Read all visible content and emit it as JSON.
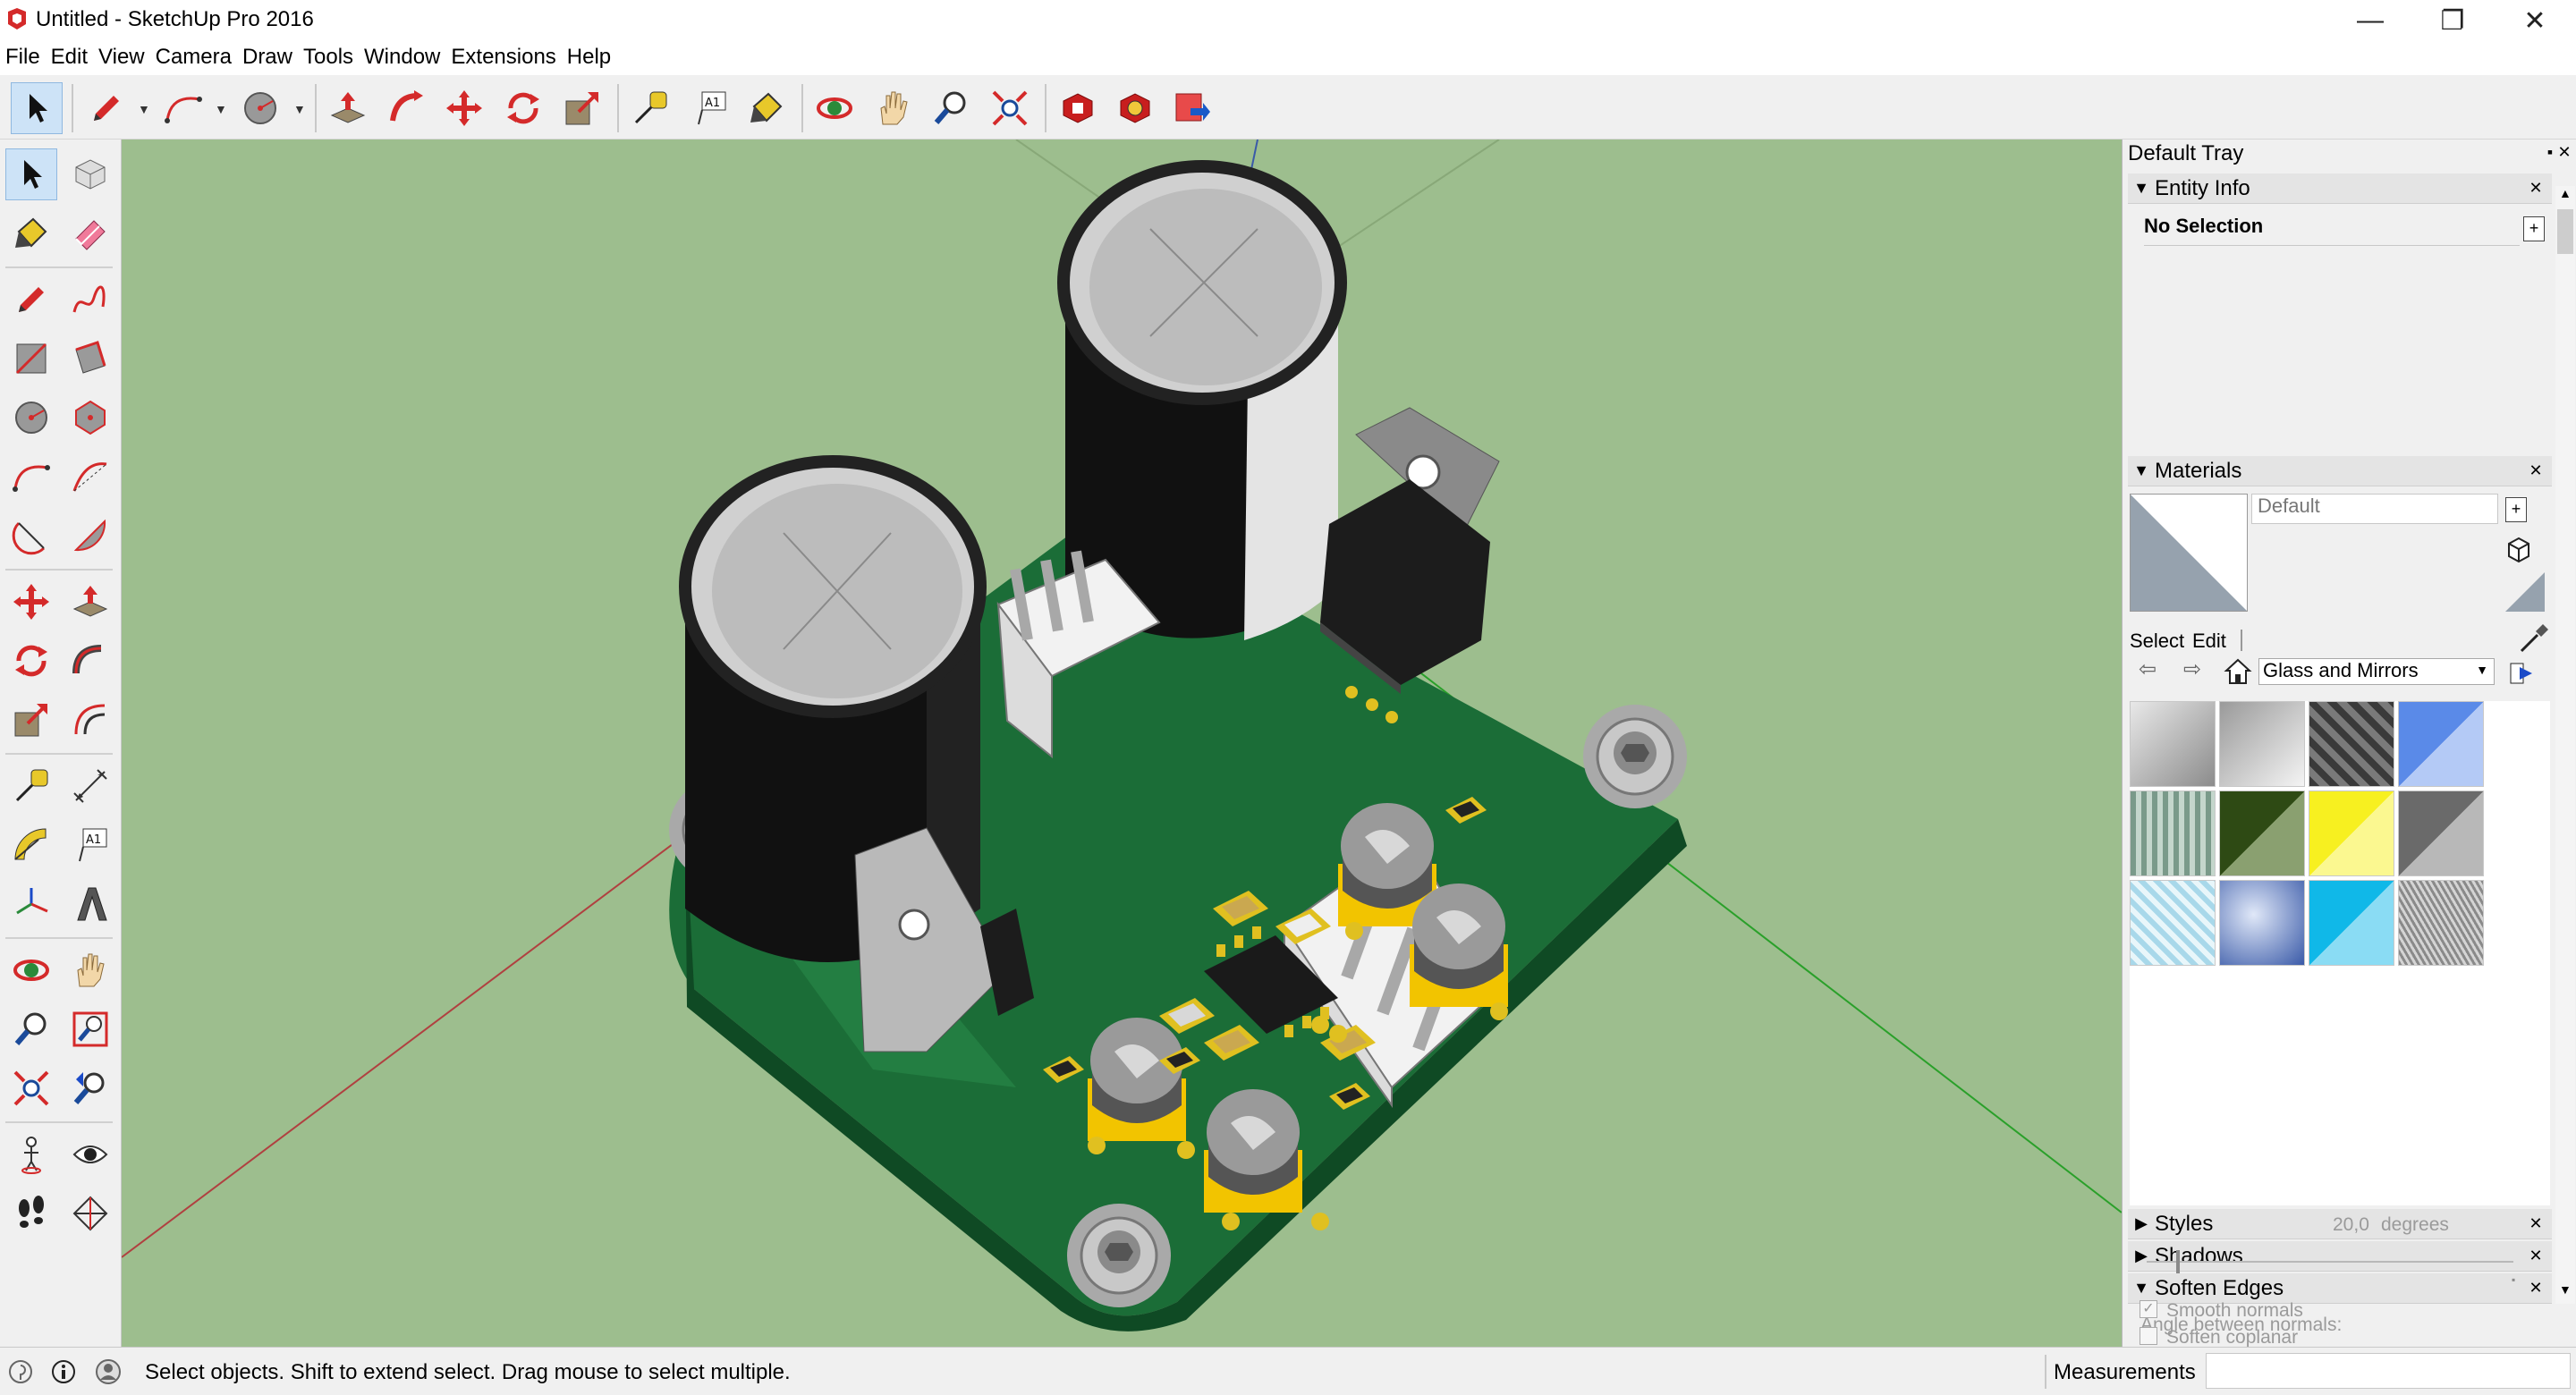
{
  "window": {
    "title": "Untitled - SketchUp Pro 2016",
    "minimize_glyph": "—",
    "restore_glyph": "❐",
    "close_glyph": "✕"
  },
  "menu": [
    "File",
    "Edit",
    "View",
    "Camera",
    "Draw",
    "Tools",
    "Window",
    "Extensions",
    "Help"
  ],
  "toolbar": {
    "icons": [
      "select-icon",
      "pencil-icon",
      "arc-icon",
      "circle-icon",
      "push-pull-icon",
      "follow-me-icon",
      "move-icon",
      "rotate-icon",
      "scale-icon",
      "tape-measure-icon",
      "text-icon",
      "paint-bucket-icon",
      "orbit-icon",
      "pan-icon",
      "zoom-icon",
      "zoom-extents-icon",
      "warehouse-icon",
      "extension-warehouse-icon",
      "share-model-icon"
    ]
  },
  "left_toolbar": {
    "text_tool_label": "A1"
  },
  "tray": {
    "title": "Default Tray",
    "entity_info": {
      "title": "Entity Info",
      "selection": "No Selection"
    },
    "materials": {
      "title": "Materials",
      "name_value": "Default",
      "tab_select": "Select",
      "tab_edit": "Edit",
      "library": "Glass and Mirrors",
      "swatch_colors": [
        "#b8b8b8",
        "#d8d8d8",
        "#4a4a4a",
        "#8fb0ee",
        "#9ab3a6",
        "#3d5a1e",
        "#f7f020",
        "#8c8c8c",
        "#cfe8f2",
        "#6a86c8",
        "#2ac5ee",
        "#a6a6a6"
      ]
    },
    "styles_title": "Styles",
    "shadows_title": "Shadows",
    "soften_edges": {
      "title": "Soften Edges",
      "angle_label": "Angle between normals:",
      "angle_value": "20,0",
      "angle_unit": "degrees",
      "smooth_normals": "Smooth normals",
      "soften_coplanar": "Soften coplanar",
      "slider_level": 0.08
    }
  },
  "status": {
    "message": "Select objects. Shift to extend select. Drag mouse to select multiple.",
    "measurements_label": "Measurements",
    "measurements_value": ""
  },
  "colors": {
    "sky": "#9dbe8e",
    "pcb": "#1f7a3f",
    "accent_red": "#d42a2a"
  }
}
